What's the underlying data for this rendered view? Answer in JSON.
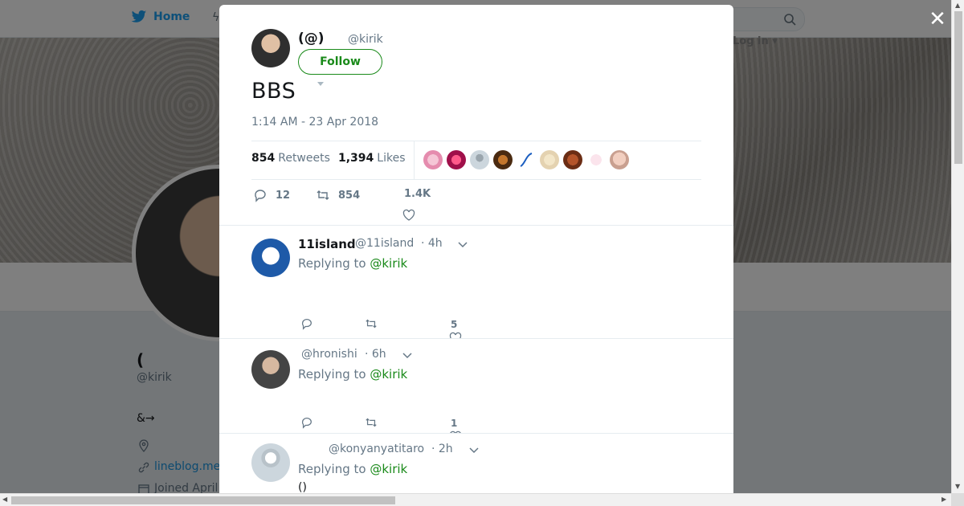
{
  "topbar": {
    "home_label": "Home"
  },
  "profile": {
    "name": "(",
    "handle": "@kirik",
    "bio": "&→",
    "link": "lineblog.me",
    "joined": "Joined April",
    "login_label": "Log in"
  },
  "tweet": {
    "author_name": "(@)",
    "author_handle": "@kirik",
    "follow_label": "Follow",
    "text": "BBS",
    "timestamp": "1:14 AM - 23 Apr 2018",
    "retweets_count": "854",
    "retweets_label": "Retweets",
    "likes_count": "1,394",
    "likes_label": "Likes",
    "likers": [
      "liker-1",
      "liker-2",
      "liker-3",
      "liker-4",
      "liker-5",
      "liker-6",
      "liker-7",
      "liker-8",
      "liker-9"
    ],
    "actions": {
      "replies": "12",
      "retweets": "854",
      "likes": "1.4K"
    }
  },
  "replies": [
    {
      "name": "11island",
      "handle": "@11island",
      "time": "· 4h",
      "replying_prefix": "Replying to",
      "replying_to": "@kirik",
      "body": "",
      "like_count": "5"
    },
    {
      "name": "",
      "handle": "@hronishi",
      "time": "· 6h",
      "replying_prefix": "Replying to",
      "replying_to": "@kirik",
      "body": "",
      "like_count": "1"
    },
    {
      "name": "",
      "handle": "@konyanyatitaro",
      "time": "· 2h",
      "replying_prefix": "Replying to",
      "replying_to": "@kirik",
      "body": "()",
      "like_count": ""
    }
  ],
  "colors": {
    "accent": "#1a8a1a",
    "twitter_blue": "#1da1f2"
  }
}
